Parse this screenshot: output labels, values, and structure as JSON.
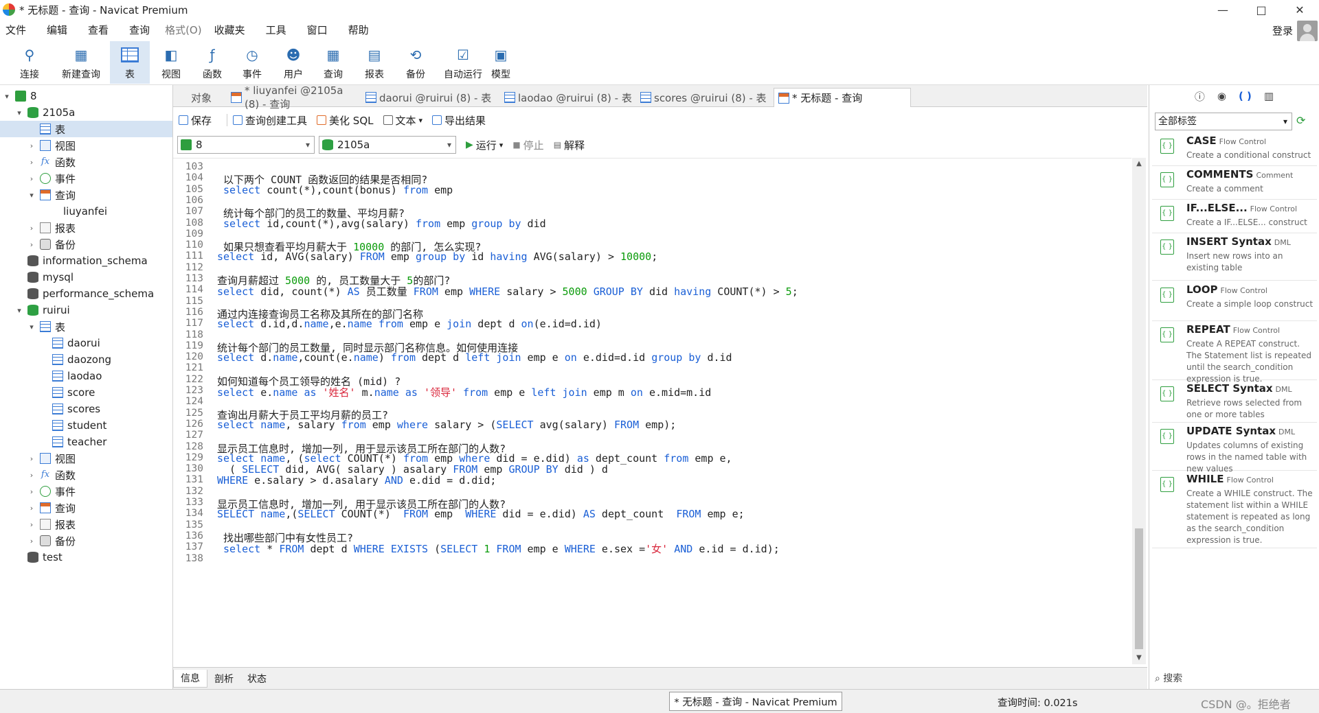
{
  "window": {
    "title": "* 无标题 - 查询 - Navicat Premium",
    "min": "—",
    "max": "□",
    "close": "✕"
  },
  "menu": [
    "文件",
    "编辑",
    "查看",
    "查询",
    "格式(O)",
    "收藏夹",
    "工具",
    "窗口",
    "帮助"
  ],
  "login": "登录",
  "toolbar": [
    {
      "label": "连接",
      "icon": "plug-icon"
    },
    {
      "label": "新建查询",
      "icon": "new-query-icon"
    },
    {
      "label": "表",
      "icon": "table-icon",
      "active": true
    },
    {
      "label": "视图",
      "icon": "view-icon"
    },
    {
      "label": "函数",
      "icon": "function-icon"
    },
    {
      "label": "事件",
      "icon": "clock-icon"
    },
    {
      "label": "用户",
      "icon": "user-icon"
    },
    {
      "label": "查询",
      "icon": "query-icon"
    },
    {
      "label": "报表",
      "icon": "report-icon"
    },
    {
      "label": "备份",
      "icon": "backup-icon"
    },
    {
      "label": "自动运行",
      "icon": "autorun-icon"
    },
    {
      "label": "模型",
      "icon": "model-icon"
    }
  ],
  "tree": [
    {
      "label": "8",
      "icon": "conn",
      "depth": 0,
      "tw": "▾"
    },
    {
      "label": "2105a",
      "icon": "db-g",
      "depth": 1,
      "tw": "▾"
    },
    {
      "label": "表",
      "icon": "tbl",
      "depth": 2,
      "tw": "",
      "selected": true
    },
    {
      "label": "视图",
      "icon": "view",
      "depth": 2,
      "tw": "›"
    },
    {
      "label": "函数",
      "icon": "fx",
      "depth": 2,
      "tw": "›"
    },
    {
      "label": "事件",
      "icon": "evt",
      "depth": 2,
      "tw": "›"
    },
    {
      "label": "查询",
      "icon": "qry",
      "depth": 2,
      "tw": "▾"
    },
    {
      "label": "liuyanfei",
      "icon": "",
      "depth": 3,
      "tw": ""
    },
    {
      "label": "报表",
      "icon": "rpt",
      "depth": 2,
      "tw": "›"
    },
    {
      "label": "备份",
      "icon": "bak",
      "depth": 2,
      "tw": "›"
    },
    {
      "label": "information_schema",
      "icon": "db",
      "depth": 1,
      "tw": ""
    },
    {
      "label": "mysql",
      "icon": "db",
      "depth": 1,
      "tw": ""
    },
    {
      "label": "performance_schema",
      "icon": "db",
      "depth": 1,
      "tw": ""
    },
    {
      "label": "ruirui",
      "icon": "db-g",
      "depth": 1,
      "tw": "▾"
    },
    {
      "label": "表",
      "icon": "tbl",
      "depth": 2,
      "tw": "▾"
    },
    {
      "label": "daorui",
      "icon": "tbl",
      "depth": 3,
      "tw": ""
    },
    {
      "label": "daozong",
      "icon": "tbl",
      "depth": 3,
      "tw": ""
    },
    {
      "label": "laodao",
      "icon": "tbl",
      "depth": 3,
      "tw": ""
    },
    {
      "label": "score",
      "icon": "tbl",
      "depth": 3,
      "tw": ""
    },
    {
      "label": "scores",
      "icon": "tbl",
      "depth": 3,
      "tw": ""
    },
    {
      "label": "student",
      "icon": "tbl",
      "depth": 3,
      "tw": ""
    },
    {
      "label": "teacher",
      "icon": "tbl",
      "depth": 3,
      "tw": ""
    },
    {
      "label": "视图",
      "icon": "view",
      "depth": 2,
      "tw": "›"
    },
    {
      "label": "函数",
      "icon": "fx",
      "depth": 2,
      "tw": "›"
    },
    {
      "label": "事件",
      "icon": "evt",
      "depth": 2,
      "tw": "›"
    },
    {
      "label": "查询",
      "icon": "qry",
      "depth": 2,
      "tw": "›"
    },
    {
      "label": "报表",
      "icon": "rpt",
      "depth": 2,
      "tw": "›"
    },
    {
      "label": "备份",
      "icon": "bak",
      "depth": 2,
      "tw": "›"
    },
    {
      "label": "test",
      "icon": "db",
      "depth": 1,
      "tw": ""
    }
  ],
  "tabs": [
    {
      "label": "对象",
      "icon": ""
    },
    {
      "label": "* liuyanfei @2105a (8) - 查询",
      "icon": "qry"
    },
    {
      "label": "daorui @ruirui (8) - 表",
      "icon": "tbl"
    },
    {
      "label": "laodao @ruirui (8) - 表",
      "icon": "tbl"
    },
    {
      "label": "scores @ruirui (8) - 表",
      "icon": "tbl"
    },
    {
      "label": "* 无标题 - 查询",
      "icon": "qry",
      "active": true
    }
  ],
  "query_toolbar": {
    "save": "保存",
    "builder": "查询创建工具",
    "beautify": "美化 SQL",
    "text": "文本",
    "export": "导出结果"
  },
  "selectors": {
    "connection": "8",
    "database": "2105a",
    "run": "运行",
    "stop": "停止",
    "explain": "解释"
  },
  "code_lines": [
    {
      "n": "103",
      "t": []
    },
    {
      "n": "104",
      "t": [
        [
          " 以下两个 COUNT 函数返回的结果是否相同?",
          ""
        ]
      ]
    },
    {
      "n": "105",
      "t": [
        [
          " ",
          ""
        ],
        [
          "select",
          "kw"
        ],
        [
          " count(*),count(bonus) ",
          ""
        ],
        [
          "from",
          "kw"
        ],
        [
          " emp",
          ""
        ]
      ]
    },
    {
      "n": "106",
      "t": []
    },
    {
      "n": "107",
      "t": [
        [
          " 统计每个部门的员工的数量、平均月薪?",
          ""
        ]
      ]
    },
    {
      "n": "108",
      "t": [
        [
          " ",
          ""
        ],
        [
          "select",
          "kw"
        ],
        [
          " id,count(*),avg(salary) ",
          ""
        ],
        [
          "from",
          "kw"
        ],
        [
          " emp ",
          ""
        ],
        [
          "group by",
          "kw"
        ],
        [
          " did",
          ""
        ]
      ]
    },
    {
      "n": "109",
      "t": []
    },
    {
      "n": "110",
      "t": [
        [
          " 如果只想查看平均月薪大于 ",
          ""
        ],
        [
          "10000",
          "num"
        ],
        [
          " 的部门, 怎么实现?",
          ""
        ]
      ]
    },
    {
      "n": "111",
      "t": [
        [
          "select",
          "kw"
        ],
        [
          " id, AVG(salary) ",
          ""
        ],
        [
          "FROM",
          "kw"
        ],
        [
          " emp ",
          ""
        ],
        [
          "group by",
          "kw"
        ],
        [
          " id ",
          ""
        ],
        [
          "having",
          "kw"
        ],
        [
          " AVG(salary) > ",
          ""
        ],
        [
          "10000",
          "num"
        ],
        [
          ";",
          ""
        ]
      ]
    },
    {
      "n": "112",
      "t": []
    },
    {
      "n": "113",
      "t": [
        [
          "查询月薪超过 ",
          ""
        ],
        [
          "5000",
          "num"
        ],
        [
          " 的, 员工数量大于 ",
          ""
        ],
        [
          "5",
          "num"
        ],
        [
          "的部门?",
          ""
        ]
      ]
    },
    {
      "n": "114",
      "t": [
        [
          "select",
          "kw"
        ],
        [
          " did, count(*) ",
          ""
        ],
        [
          "AS",
          "kw"
        ],
        [
          " 员工数量 ",
          ""
        ],
        [
          "FROM",
          "kw"
        ],
        [
          " emp ",
          ""
        ],
        [
          "WHERE",
          "kw"
        ],
        [
          " salary > ",
          ""
        ],
        [
          "5000",
          "num"
        ],
        [
          " ",
          ""
        ],
        [
          "GROUP BY",
          "kw"
        ],
        [
          " did ",
          ""
        ],
        [
          "having",
          "kw"
        ],
        [
          " COUNT(*) > ",
          ""
        ],
        [
          "5",
          "num"
        ],
        [
          ";",
          ""
        ]
      ]
    },
    {
      "n": "115",
      "t": []
    },
    {
      "n": "116",
      "t": [
        [
          "通过内连接查询员工名称及其所在的部门名称",
          ""
        ]
      ]
    },
    {
      "n": "117",
      "t": [
        [
          "select",
          "kw"
        ],
        [
          " d.id,d.",
          ""
        ],
        [
          "name",
          "kw"
        ],
        [
          ",e.",
          ""
        ],
        [
          "name",
          "kw"
        ],
        [
          " ",
          ""
        ],
        [
          "from",
          "kw"
        ],
        [
          " emp e ",
          ""
        ],
        [
          "join",
          "kw"
        ],
        [
          " dept d ",
          ""
        ],
        [
          "on",
          "kw"
        ],
        [
          "(e.id=d.id)",
          ""
        ]
      ]
    },
    {
      "n": "118",
      "t": []
    },
    {
      "n": "119",
      "t": [
        [
          "统计每个部门的员工数量, 同时显示部门名称信息。如何使用连接",
          ""
        ]
      ]
    },
    {
      "n": "120",
      "t": [
        [
          "select",
          "kw"
        ],
        [
          " d.",
          ""
        ],
        [
          "name",
          "kw"
        ],
        [
          ",count(e.",
          ""
        ],
        [
          "name",
          "kw"
        ],
        [
          ") ",
          ""
        ],
        [
          "from",
          "kw"
        ],
        [
          " dept d ",
          ""
        ],
        [
          "left join",
          "kw"
        ],
        [
          " emp e ",
          ""
        ],
        [
          "on",
          "kw"
        ],
        [
          " e.did=d.id ",
          ""
        ],
        [
          "group by",
          "kw"
        ],
        [
          " d.id",
          ""
        ]
      ]
    },
    {
      "n": "121",
      "t": []
    },
    {
      "n": "122",
      "t": [
        [
          "如何知道每个员工领导的姓名 (mid) ?",
          ""
        ]
      ]
    },
    {
      "n": "123",
      "t": [
        [
          "select",
          "kw"
        ],
        [
          " e.",
          ""
        ],
        [
          "name",
          "kw"
        ],
        [
          " ",
          ""
        ],
        [
          "as",
          "kw"
        ],
        [
          " ",
          ""
        ],
        [
          "'姓名'",
          "str"
        ],
        [
          " m.",
          ""
        ],
        [
          "name",
          "kw"
        ],
        [
          " ",
          ""
        ],
        [
          "as",
          "kw"
        ],
        [
          " ",
          ""
        ],
        [
          "'领导'",
          "str"
        ],
        [
          " ",
          ""
        ],
        [
          "from",
          "kw"
        ],
        [
          " emp e ",
          ""
        ],
        [
          "left join",
          "kw"
        ],
        [
          " emp m ",
          ""
        ],
        [
          "on",
          "kw"
        ],
        [
          " e.mid=m.id",
          ""
        ]
      ]
    },
    {
      "n": "124",
      "t": []
    },
    {
      "n": "125",
      "t": [
        [
          "查询出月薪大于员工平均月薪的员工?",
          ""
        ]
      ]
    },
    {
      "n": "126",
      "t": [
        [
          "select",
          "kw"
        ],
        [
          " ",
          ""
        ],
        [
          "name",
          "kw"
        ],
        [
          ", salary ",
          ""
        ],
        [
          "from",
          "kw"
        ],
        [
          " emp ",
          ""
        ],
        [
          "where",
          "kw"
        ],
        [
          " salary > (",
          ""
        ],
        [
          "SELECT",
          "kw"
        ],
        [
          " avg(salary) ",
          ""
        ],
        [
          "FROM",
          "kw"
        ],
        [
          " emp);",
          ""
        ]
      ]
    },
    {
      "n": "127",
      "t": []
    },
    {
      "n": "128",
      "t": [
        [
          "显示员工信息时, 增加一列, 用于显示该员工所在部门的人数?",
          ""
        ]
      ]
    },
    {
      "n": "129",
      "t": [
        [
          "select",
          "kw"
        ],
        [
          " ",
          ""
        ],
        [
          "name",
          "kw"
        ],
        [
          ", (",
          ""
        ],
        [
          "select",
          "kw"
        ],
        [
          " COUNT(*) ",
          ""
        ],
        [
          "from",
          "kw"
        ],
        [
          " emp ",
          ""
        ],
        [
          "where",
          "kw"
        ],
        [
          " did = e.did) ",
          ""
        ],
        [
          "as",
          "kw"
        ],
        [
          " dept_count ",
          ""
        ],
        [
          "from",
          "kw"
        ],
        [
          " emp e,",
          ""
        ]
      ]
    },
    {
      "n": "130",
      "t": [
        [
          "  ( ",
          ""
        ],
        [
          "SELECT",
          "kw"
        ],
        [
          " did, AVG( salary ) asalary ",
          ""
        ],
        [
          "FROM",
          "kw"
        ],
        [
          " emp ",
          ""
        ],
        [
          "GROUP BY",
          "kw"
        ],
        [
          " did ) d",
          ""
        ]
      ]
    },
    {
      "n": "131",
      "t": [
        [
          "WHERE",
          "kw"
        ],
        [
          " e.salary > d.asalary ",
          ""
        ],
        [
          "AND",
          "kw"
        ],
        [
          " e.did = d.did;",
          ""
        ]
      ]
    },
    {
      "n": "132",
      "t": []
    },
    {
      "n": "133",
      "t": [
        [
          "显示员工信息时, 增加一列, 用于显示该员工所在部门的人数?",
          ""
        ]
      ]
    },
    {
      "n": "134",
      "t": [
        [
          "SELECT",
          "kw"
        ],
        [
          " ",
          ""
        ],
        [
          "name",
          "kw"
        ],
        [
          ",(",
          ""
        ],
        [
          "SELECT",
          "kw"
        ],
        [
          " COUNT(*)  ",
          ""
        ],
        [
          "FROM",
          "kw"
        ],
        [
          " emp  ",
          ""
        ],
        [
          "WHERE",
          "kw"
        ],
        [
          " did = e.did) ",
          ""
        ],
        [
          "AS",
          "kw"
        ],
        [
          " dept_count  ",
          ""
        ],
        [
          "FROM",
          "kw"
        ],
        [
          " emp e;",
          ""
        ]
      ]
    },
    {
      "n": "135",
      "t": []
    },
    {
      "n": "136",
      "t": [
        [
          " 找出哪些部门中有女性员工?",
          ""
        ]
      ]
    },
    {
      "n": "137",
      "t": [
        [
          " ",
          ""
        ],
        [
          "select",
          "kw"
        ],
        [
          " * ",
          ""
        ],
        [
          "FROM",
          "kw"
        ],
        [
          " dept d ",
          ""
        ],
        [
          "WHERE",
          "kw"
        ],
        [
          " ",
          ""
        ],
        [
          "EXISTS",
          "kw"
        ],
        [
          " (",
          ""
        ],
        [
          "SELECT",
          "kw"
        ],
        [
          " ",
          ""
        ],
        [
          "1",
          "num"
        ],
        [
          " ",
          ""
        ],
        [
          "FROM",
          "kw"
        ],
        [
          " emp e ",
          ""
        ],
        [
          "WHERE",
          "kw"
        ],
        [
          " e.sex =",
          ""
        ],
        [
          "'女'",
          "str"
        ],
        [
          " ",
          ""
        ],
        [
          "AND",
          "kw"
        ],
        [
          " e.id = d.id);",
          ""
        ]
      ]
    },
    {
      "n": "138",
      "t": []
    }
  ],
  "bottom_tabs": [
    "信息",
    "剖析",
    "状态"
  ],
  "right_panel": {
    "tag_select": "全部标签",
    "search": "搜索",
    "snippets": [
      {
        "name": "CASE",
        "type": "Flow Control",
        "desc": "Create a conditional construct"
      },
      {
        "name": "COMMENTS",
        "type": "Comment",
        "desc": "Create a comment"
      },
      {
        "name": "IF...ELSE...",
        "type": "Flow Control",
        "desc": "Create a IF...ELSE... construct"
      },
      {
        "name": "INSERT Syntax",
        "type": "DML",
        "desc": "Insert new rows into an existing table"
      },
      {
        "name": "LOOP",
        "type": "Flow Control",
        "desc": "Create a simple loop construct"
      },
      {
        "name": "REPEAT",
        "type": "Flow Control",
        "desc": "Create A REPEAT construct. The Statement list is repeated until the search_condition expression is true."
      },
      {
        "name": "SELECT Syntax",
        "type": "DML",
        "desc": "Retrieve rows selected from one or more tables"
      },
      {
        "name": "UPDATE Syntax",
        "type": "DML",
        "desc": "Updates columns of existing rows in the named table with new values"
      },
      {
        "name": "WHILE",
        "type": "Flow Control",
        "desc": "Create a WHILE construct. The statement list within a WHILE statement is repeated as long as the search_condition expression is true."
      }
    ]
  },
  "statusbar": {
    "task": "* 无标题 - 查询 - Navicat Premium",
    "query_time": "查询时间: 0.021s",
    "watermark": "CSDN @。拒绝者"
  }
}
